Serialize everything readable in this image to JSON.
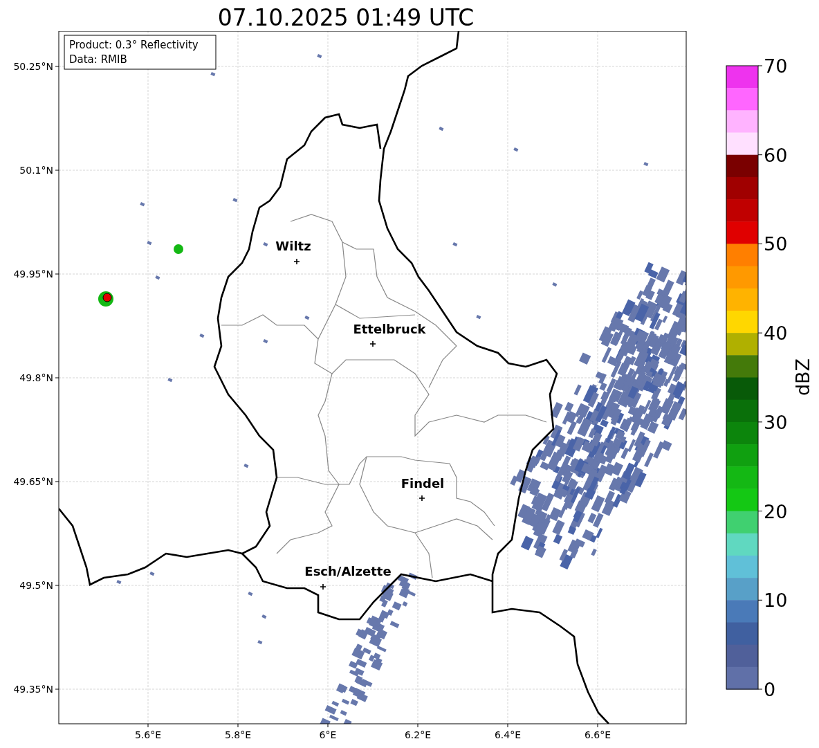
{
  "title": "07.10.2025 01:49 UTC",
  "map": {
    "info_lines": [
      "Product: 0.3° Reflectivity",
      "Data: RMIB"
    ],
    "cities": [
      {
        "name": "Wiltz"
      },
      {
        "name": "Ettelbruck"
      },
      {
        "name": "Findel"
      },
      {
        "name": "Esch/Alzette"
      }
    ],
    "xticks": [
      "5.6°E",
      "5.8°E",
      "6°E",
      "6.2°E",
      "6.4°E",
      "6.6°E"
    ],
    "yticks": [
      "50.25°N",
      "50.1°N",
      "49.95°N",
      "49.8°N",
      "49.65°N",
      "49.5°N",
      "49.35°N"
    ]
  },
  "colorbar": {
    "label": "dBZ",
    "ticks": [
      "70",
      "60",
      "50",
      "40",
      "30",
      "20",
      "10",
      "0"
    ],
    "segments": [
      {
        "color": "#ee33ee"
      },
      {
        "color": "#ff66ff"
      },
      {
        "color": "#ffb3ff"
      },
      {
        "color": "#ffe0ff"
      },
      {
        "color": "#7a0000"
      },
      {
        "color": "#a00000"
      },
      {
        "color": "#c00000"
      },
      {
        "color": "#e00000"
      },
      {
        "color": "#ff7f00"
      },
      {
        "color": "#ff9900"
      },
      {
        "color": "#ffb300"
      },
      {
        "color": "#ffd700"
      },
      {
        "color": "#b0b000"
      },
      {
        "color": "#447a0a"
      },
      {
        "color": "#085a08"
      },
      {
        "color": "#0a700a"
      },
      {
        "color": "#0c850c"
      },
      {
        "color": "#10a010"
      },
      {
        "color": "#14b814"
      },
      {
        "color": "#14c814"
      },
      {
        "color": "#40d070"
      },
      {
        "color": "#60d8c0"
      },
      {
        "color": "#60c0d8"
      },
      {
        "color": "#58a0c8"
      },
      {
        "color": "#4a7ab8"
      },
      {
        "color": "#4060a0"
      },
      {
        "color": "#50609a"
      },
      {
        "color": "#6070a8"
      }
    ]
  }
}
